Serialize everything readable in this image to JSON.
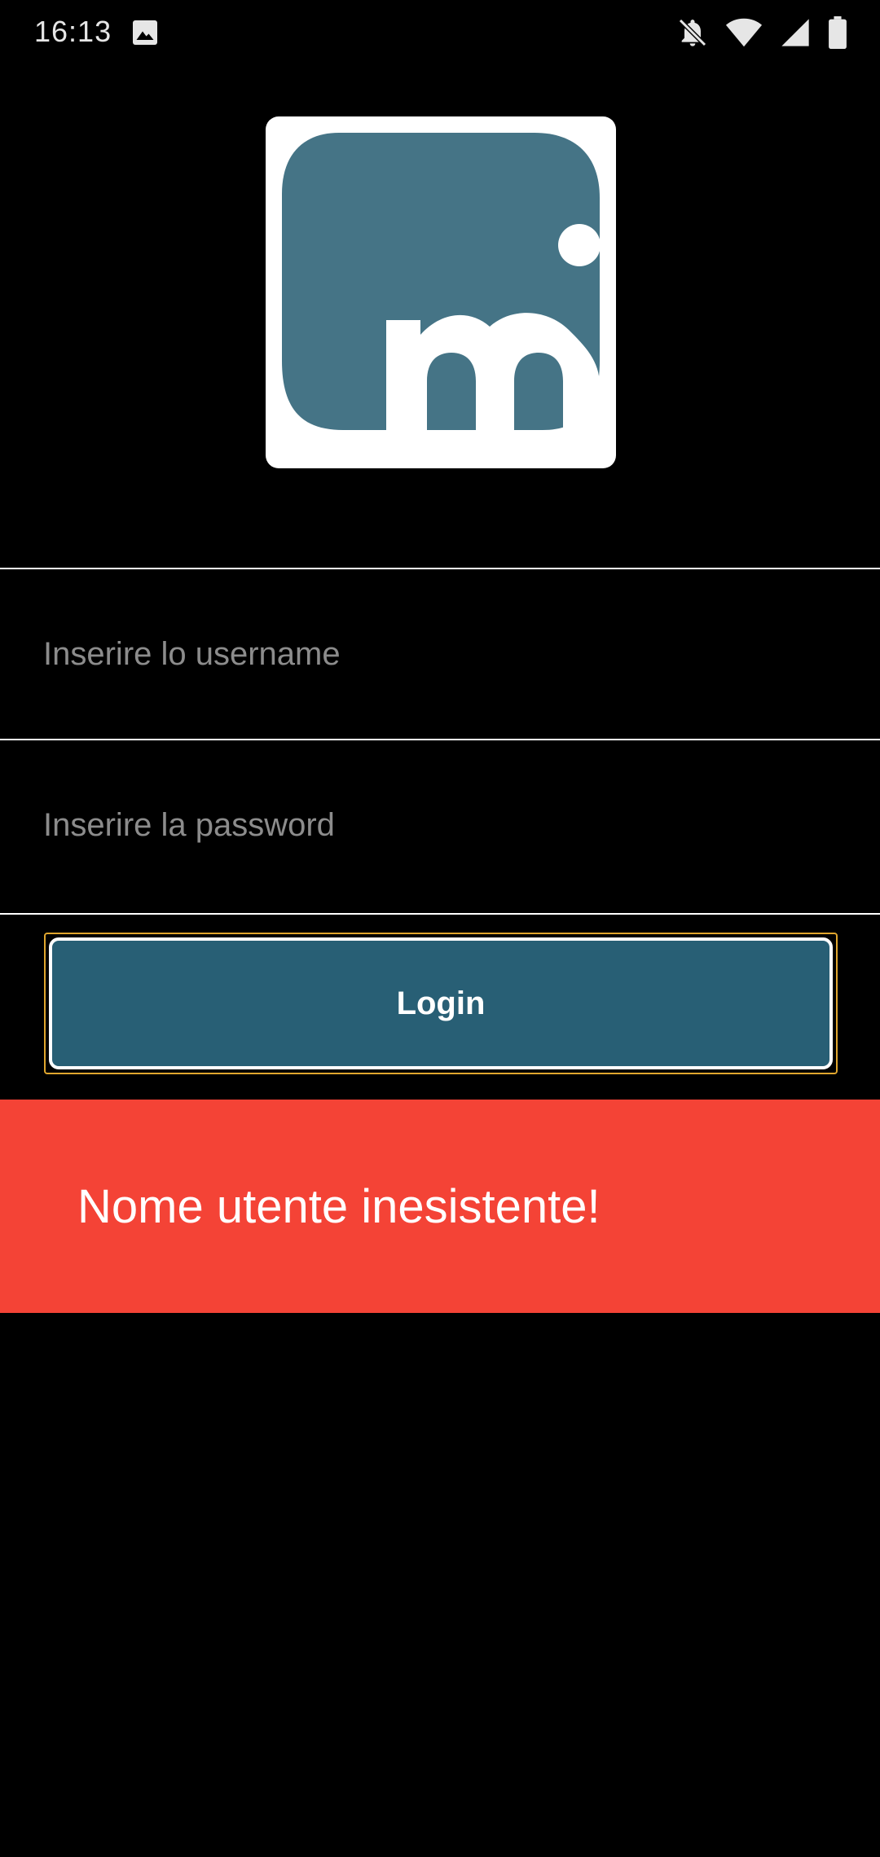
{
  "status_bar": {
    "time": "16:13",
    "left_icons": [
      "image-icon"
    ],
    "right_icons": [
      "notifications-off-icon",
      "wifi-icon",
      "cellular-signal-icon",
      "battery-icon"
    ]
  },
  "logo": {
    "icon": "app-logo-m",
    "colors": {
      "background": "#ffffff",
      "mark": "#457486"
    }
  },
  "form": {
    "username": {
      "placeholder": "Inserire lo username",
      "value": ""
    },
    "password": {
      "placeholder": "Inserire la password",
      "value": ""
    },
    "login_label": "Login"
  },
  "snackbar": {
    "message": "Nome utente inesistente!"
  },
  "colors": {
    "background": "#000000",
    "button": "#285f75",
    "button_focus_ring": "#e0a62e",
    "error": "#f44336",
    "placeholder": "#8c8c8c"
  }
}
